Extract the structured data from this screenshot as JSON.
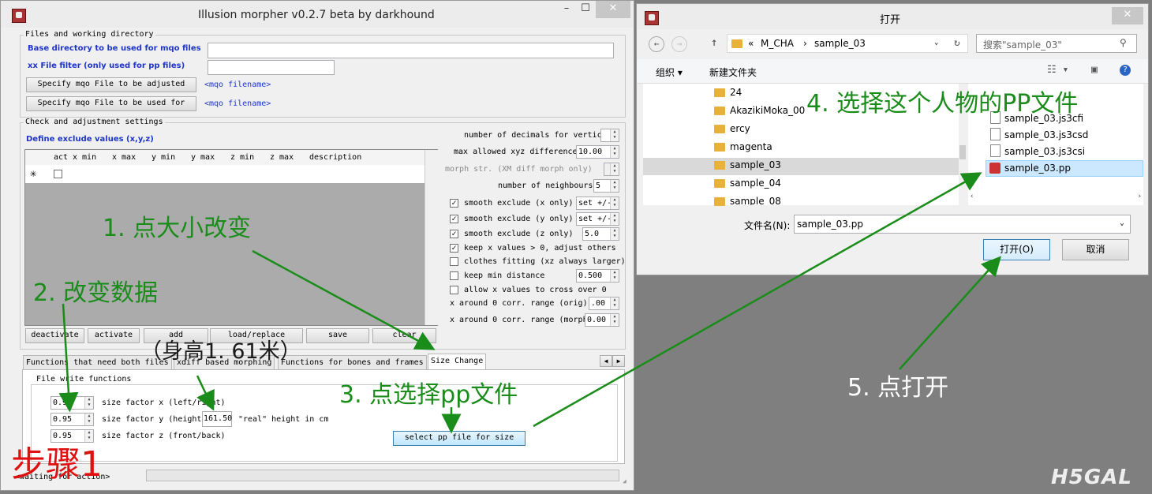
{
  "morpher": {
    "title": "Illusion morpher v0.2.7 beta by darkhound",
    "files_group": "Files and working directory",
    "base_dir_label": "Base directory to be used  for mqo files",
    "base_dir_value": "",
    "xx_filter_label": "xx File filter (only used for pp files)",
    "xx_filter_value": "",
    "specify_adjusted_btn": "Specify mqo File to be adjusted",
    "specify_used_btn": "Specify mqo File to be used for",
    "mqo_filename_1": "<mqo filename>",
    "mqo_filename_2": "<mqo filename>",
    "check_group": "Check and adjustment settings",
    "define_exclude": "Define exclude values (x,y,z)",
    "grid_headers": [
      "act",
      "x min",
      "x max",
      "y min",
      "y max",
      "z min",
      "z max",
      "description"
    ],
    "grid_new_row_marker": "✳",
    "settings": {
      "decimals_label": "number of decimals for vertices",
      "max_xyz_label": "max allowed xyz difference",
      "max_xyz_value": "10.00",
      "morph_str_label": "morph str. (XM diff morph only)",
      "neighbours_label": "number of neighbours",
      "neighbours_value": "5",
      "smooth_x_label": "smooth exclude (x only)",
      "smooth_y_label": "smooth exclude (y only)",
      "smooth_z_label": "smooth exclude (z only)",
      "set_pm": "set +/-",
      "smooth_z_value": "5.0",
      "keep_x_label": "keep x values > 0, adjust others",
      "clothes_label": "clothes fitting (xz always larger)",
      "keep_min_label": "keep min distance",
      "keep_min_value": "0.500",
      "allow_cross_label": "allow x values to cross over 0",
      "x_around_orig_label": "x around 0 corr. range (orig)",
      "x_around_orig_value": ".00",
      "x_around_morph_label": "x around 0 corr. range (morph)",
      "x_around_morph_value": "0.00"
    },
    "buttons": [
      "deactivate",
      "activate",
      "add",
      "load/replace",
      "save",
      "clear"
    ],
    "tabs": [
      "Functions that need both files",
      "xdiff based morphing",
      "Functions for bones and frames",
      "Size Change"
    ],
    "file_write_group": "File write functions",
    "size_x_value": "0.95",
    "size_x_label": "size factor x (left/right)",
    "size_y_value": "0.95",
    "size_y_label": "size factor y (height",
    "height_value": "161.50",
    "height_label": "\"real\" height in cm",
    "size_z_value": "0.95",
    "size_z_label": "size factor z (front/back)",
    "select_pp_btn": "select pp file for size",
    "status": "<waiting for action>"
  },
  "dialog": {
    "title": "打开",
    "breadcrumb": [
      "«",
      "M_CHA",
      "›",
      "sample_03"
    ],
    "search_placeholder": "搜索\"sample_03\"",
    "organize": "组织 ▾",
    "new_folder": "新建文件夹",
    "folders": [
      "24",
      "AkazikiMoka_00",
      "ercy",
      "magenta",
      "sample_03",
      "sample_04",
      "sample_08"
    ],
    "files": [
      "sample_03.js3cfi",
      "sample_03.js3csd",
      "sample_03.js3csi",
      "sample_03.pp"
    ],
    "filename_label": "文件名(N):",
    "filename_value": "sample_03.pp",
    "open_btn": "打开(O)",
    "cancel_btn": "取消"
  },
  "annotations": {
    "step1": "1. 点大小改变",
    "step2": "2. 改变数据",
    "height_note": "（身高1. 61米）",
    "step3": "3. 点选择pp文件",
    "step4": "4. 选择这个人物的PP文件",
    "step5": "5. 点打开",
    "steps_title": "步骤1",
    "watermark": "H5GAL"
  },
  "colors": {
    "annotation_green": "#1a8c1a",
    "step_red": "#e01010",
    "link_blue": "#1f35c8"
  }
}
